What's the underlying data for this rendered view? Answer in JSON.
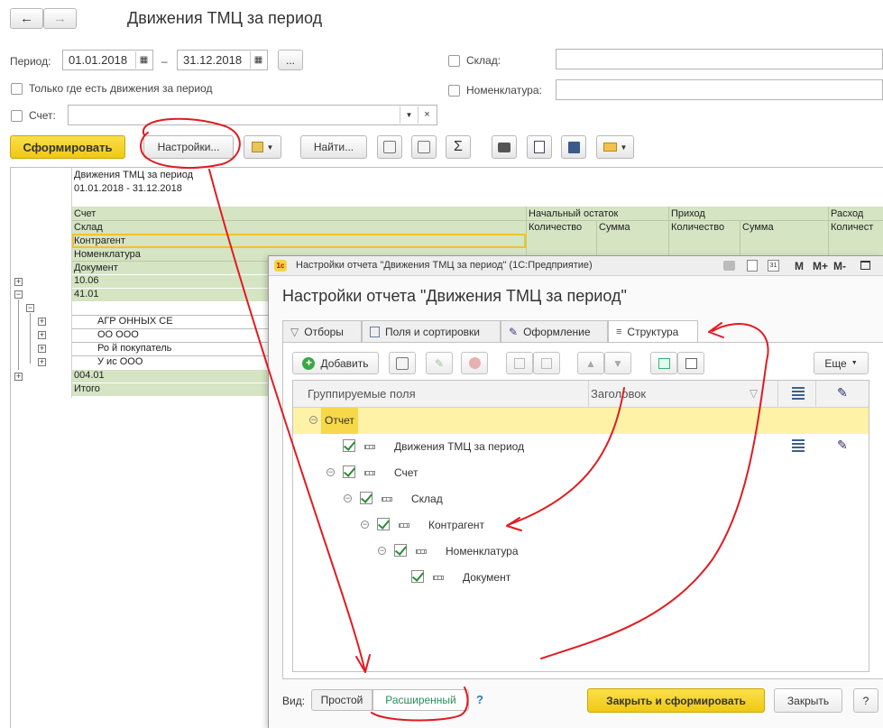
{
  "header": {
    "title": "Движения ТМЦ за период"
  },
  "filters": {
    "period_label": "Период:",
    "date_from": "01.01.2018",
    "date_to": "31.12.2018",
    "dash": "–",
    "ellipsis_button": "...",
    "only_movements_label": "Только где есть движения за период",
    "account_label": "Счет:",
    "warehouse_label": "Склад:",
    "nomenclature_label": "Номенклатура:"
  },
  "toolbar": {
    "generate": "Сформировать",
    "settings": "Настройки...",
    "find": "Найти...",
    "sum_symbol": "Σ"
  },
  "report": {
    "title": "Движения ТМЦ за период",
    "period": "01.01.2018 - 31.12.2018",
    "header_rows": [
      "Счет",
      "Склад",
      "Контрагент",
      "Номенклатура",
      "Документ"
    ],
    "col_groups": [
      "Начальный остаток",
      "Приход",
      "Расход"
    ],
    "sub_cols": [
      "Количество",
      "Сумма",
      "Количество",
      "Сумма",
      "Количест"
    ],
    "rows": [
      {
        "text": "10.06"
      },
      {
        "text": "41.01"
      },
      {
        "text": ""
      },
      {
        "text": "АГР          ОННЫХ СЕ"
      },
      {
        "text": "ОО      ООО"
      },
      {
        "text": "Ро         й покупатель"
      },
      {
        "text": "У        ис ООО"
      },
      {
        "text": "004.01"
      },
      {
        "text": "Итого"
      }
    ]
  },
  "dialog": {
    "window_title": "Настройки отчета \"Движения ТМЦ за период\"  (1С:Предприятие)",
    "heading": "Настройки отчета \"Движения ТМЦ за период\"",
    "title_controls": [
      "M",
      "M+",
      "M-"
    ],
    "tabs": [
      {
        "label": "Отборы"
      },
      {
        "label": "Поля и сортировки"
      },
      {
        "label": "Оформление"
      },
      {
        "label": "Структура"
      }
    ],
    "add_button": "Добавить",
    "more_button": "Еще",
    "columns": {
      "fields": "Группируемые поля",
      "caption": "Заголовок"
    },
    "tree": [
      {
        "label": "Отчет"
      },
      {
        "label": "Движения ТМЦ за период"
      },
      {
        "label": "Счет"
      },
      {
        "label": "Склад"
      },
      {
        "label": "Контрагент"
      },
      {
        "label": "Номенклатура"
      },
      {
        "label": "Документ"
      }
    ],
    "view_label": "Вид:",
    "view_simple": "Простой",
    "view_extended": "Расширенный",
    "help": "?",
    "close_generate": "Закрыть и сформировать",
    "close": "Закрыть"
  },
  "colors": {
    "accent_yellow": "#f5d22a",
    "report_green": "#d5e4c3",
    "annotation_red": "#e11b22"
  }
}
